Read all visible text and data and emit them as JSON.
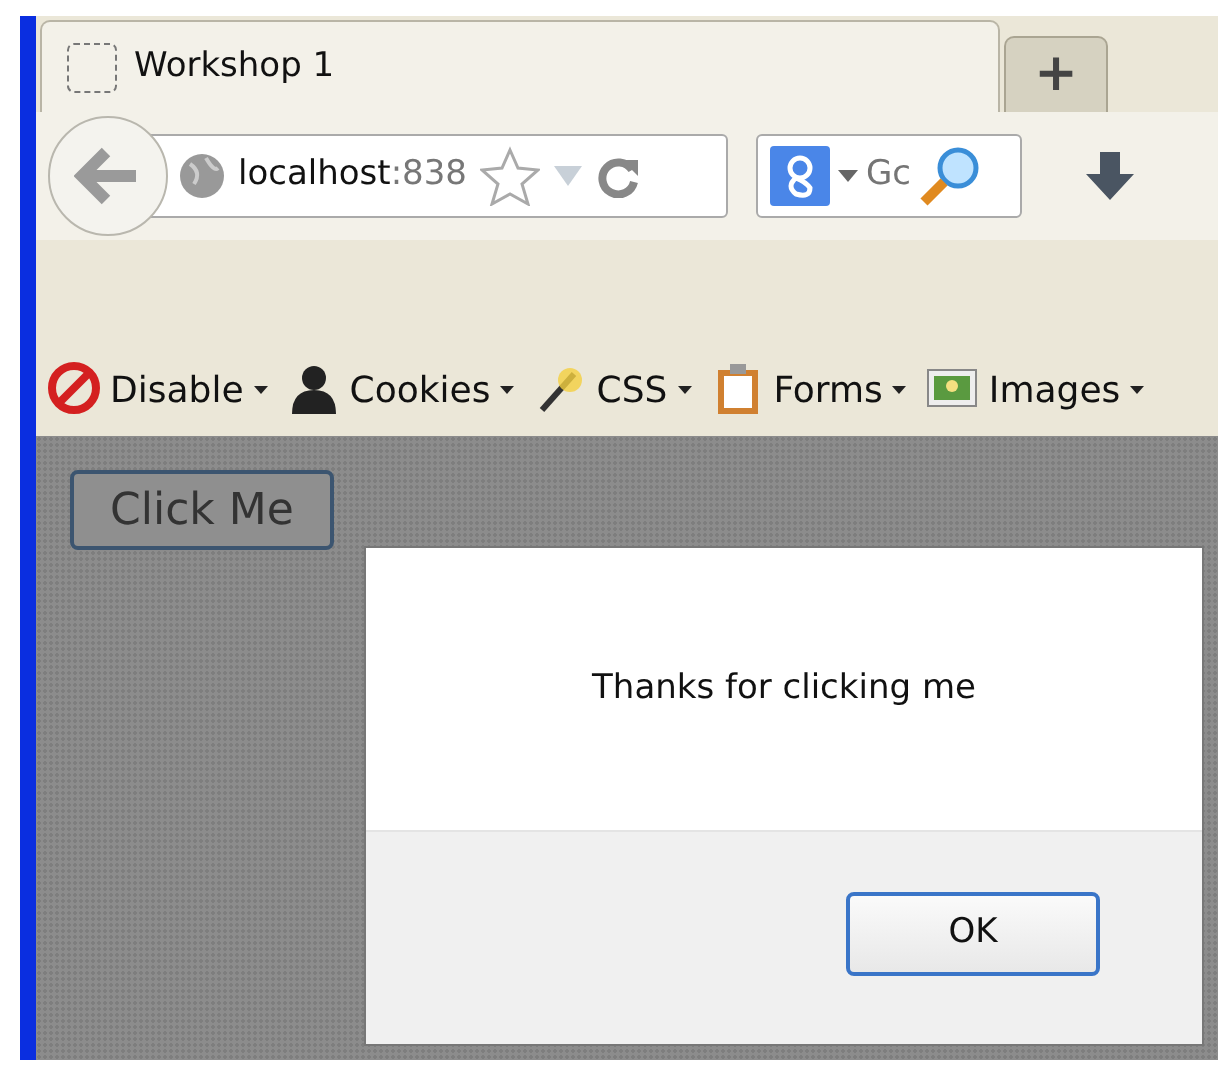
{
  "tab": {
    "title": "Workshop 1",
    "selected": true
  },
  "new_tab": "+",
  "address": {
    "host": "localhost",
    "rest": ":838"
  },
  "search": {
    "placeholder": "Gc"
  },
  "toolbar": [
    {
      "label": "Disable",
      "kind": "disable"
    },
    {
      "label": "Cookies",
      "kind": "cookies"
    },
    {
      "label": "CSS",
      "kind": "css"
    },
    {
      "label": "Forms",
      "kind": "forms"
    },
    {
      "label": "Images",
      "kind": "images"
    }
  ],
  "page": {
    "button": "Click Me"
  },
  "dialog": {
    "message": "Thanks for clicking me",
    "button": "OK"
  }
}
